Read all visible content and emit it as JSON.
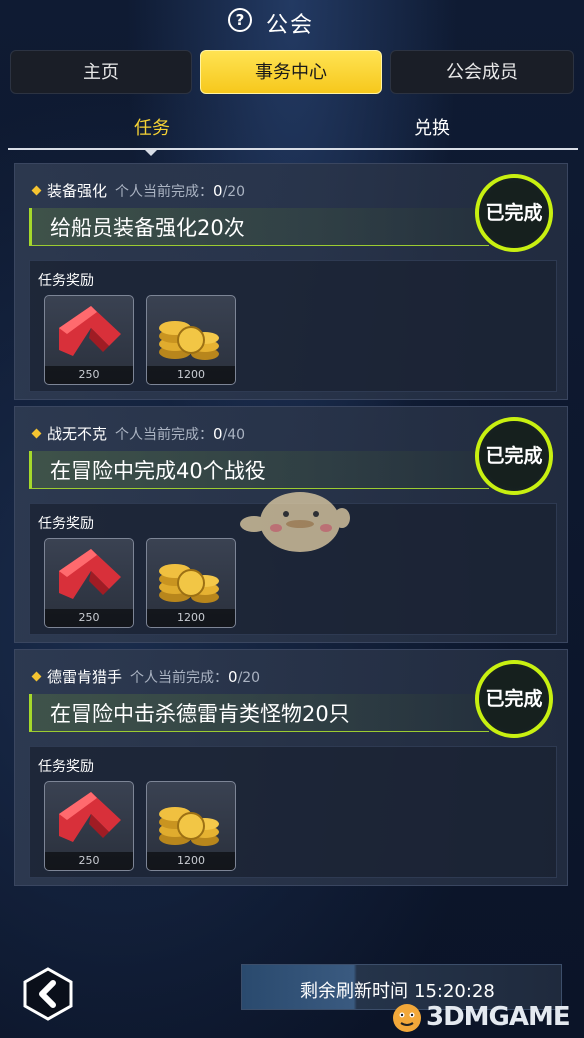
{
  "header": {
    "title": "公会",
    "help_icon": "?"
  },
  "top_tabs": [
    {
      "label": "主页",
      "active": false
    },
    {
      "label": "事务中心",
      "active": true
    },
    {
      "label": "公会成员",
      "active": false
    }
  ],
  "sub_tabs": [
    {
      "label": "任务",
      "active": true
    },
    {
      "label": "兑换",
      "active": false
    }
  ],
  "missions": [
    {
      "name": "装备强化",
      "progress_label": "个人当前完成：",
      "progress_count": "0",
      "progress_total": "/20",
      "description": "给船员装备强化20次",
      "status": "已完成",
      "rewards_label": "任务奖励",
      "rewards": [
        {
          "icon": "red-chevron-icon",
          "qty": "250"
        },
        {
          "icon": "gold-coins-icon",
          "qty": "1200"
        }
      ]
    },
    {
      "name": "战无不克",
      "progress_label": "个人当前完成：",
      "progress_count": "0",
      "progress_total": "/40",
      "description": "在冒险中完成40个战役",
      "status": "已完成",
      "rewards_label": "任务奖励",
      "rewards": [
        {
          "icon": "red-chevron-icon",
          "qty": "250"
        },
        {
          "icon": "gold-coins-icon",
          "qty": "1200"
        }
      ]
    },
    {
      "name": "德雷肯猎手",
      "progress_label": "个人当前完成：",
      "progress_count": "0",
      "progress_total": "/20",
      "description": "在冒险中击杀德雷肯类怪物20只",
      "status": "已完成",
      "rewards_label": "任务奖励",
      "rewards": [
        {
          "icon": "red-chevron-icon",
          "qty": "250"
        },
        {
          "icon": "gold-coins-icon",
          "qty": "1200"
        }
      ]
    }
  ],
  "footer": {
    "refresh_label": "剩余刷新时间",
    "refresh_time": "15:20:28",
    "back_icon": "back-chevron-icon"
  },
  "watermark": {
    "text": "3DMGAME"
  },
  "colors": {
    "accent_yellow": "#f5d235",
    "stamp_green": "#c8f011",
    "bg": "#0f1b33"
  }
}
